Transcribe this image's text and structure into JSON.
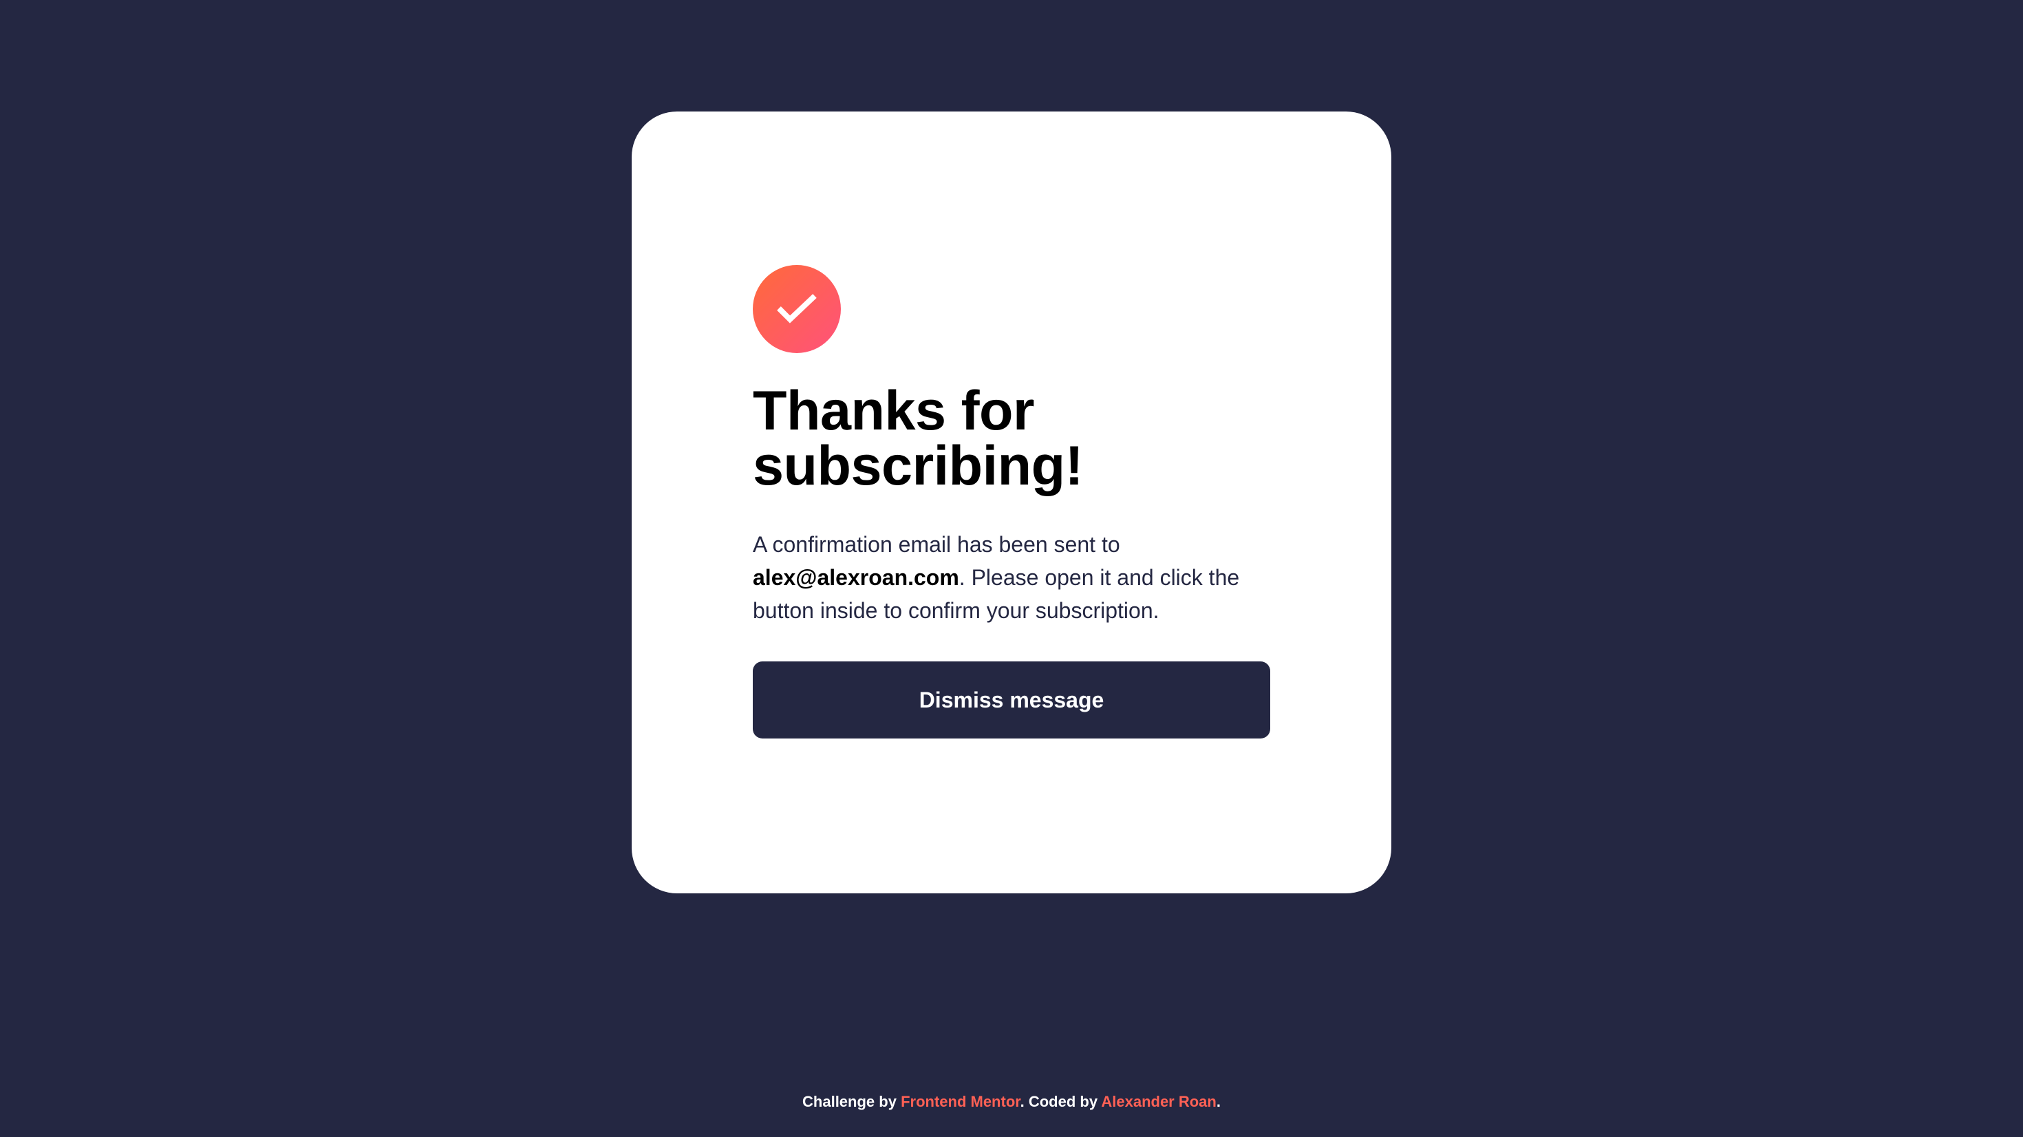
{
  "card": {
    "icon": "check-icon",
    "title_line1": "Thanks for",
    "title_line2": "subscribing!",
    "message_before": "A confirmation email has been sent to",
    "email": "alex@alexroan.com",
    "message_after": ". Please open it and click the button inside to confirm your subscription.",
    "dismiss_label": "Dismiss message"
  },
  "footer": {
    "challenge_prefix": "Challenge by",
    "challenge_link": "Frontend Mentor",
    "coded_prefix": ". Coded by",
    "coded_link": "Alexander Roan",
    "suffix": "."
  },
  "colors": {
    "background": "#242742",
    "card": "#ffffff",
    "accent_start": "#ff6a3a",
    "accent_end": "#ff527b",
    "link": "#ff6155"
  }
}
